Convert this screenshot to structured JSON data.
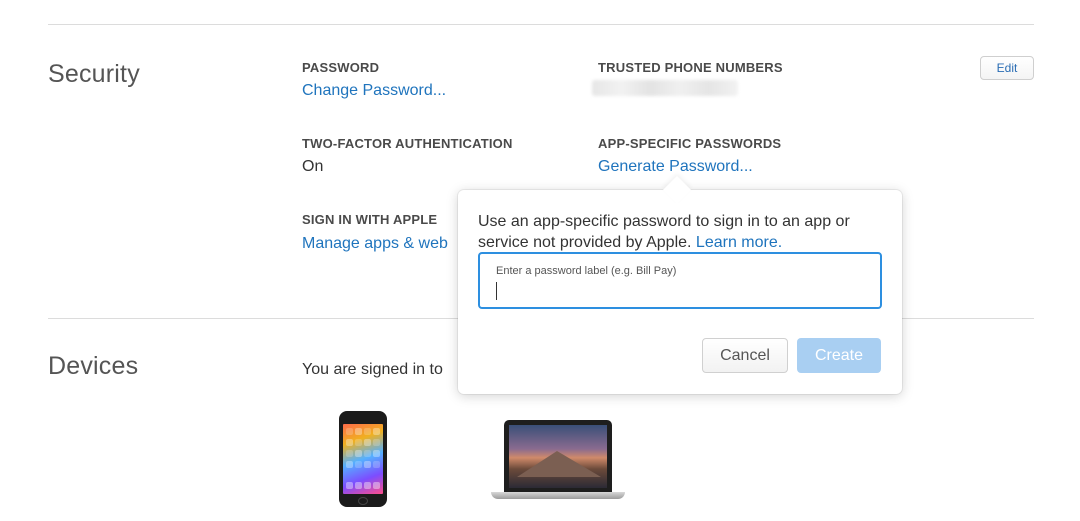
{
  "security": {
    "title": "Security",
    "edit_label": "Edit",
    "password": {
      "label": "PASSWORD",
      "link": "Change Password..."
    },
    "trusted_phones": {
      "label": "TRUSTED PHONE NUMBERS"
    },
    "two_factor": {
      "label": "TWO-FACTOR AUTHENTICATION",
      "value": "On"
    },
    "app_passwords": {
      "label": "APP-SPECIFIC PASSWORDS",
      "link": "Generate Password..."
    },
    "sign_in_apple": {
      "label": "SIGN IN WITH APPLE",
      "link": "Manage apps & web"
    }
  },
  "devices": {
    "title": "Devices",
    "signed_in_text": "You are signed in to"
  },
  "popover": {
    "description": "Use an app-specific password to sign in to an app or service not provided by Apple.",
    "learn_more": "Learn more.",
    "input_placeholder": "Enter a password label (e.g. Bill Pay)",
    "cancel_label": "Cancel",
    "create_label": "Create"
  },
  "colors": {
    "link": "#1f74bd",
    "focus": "#2d8fe0",
    "create_disabled": "#a9cff2"
  }
}
